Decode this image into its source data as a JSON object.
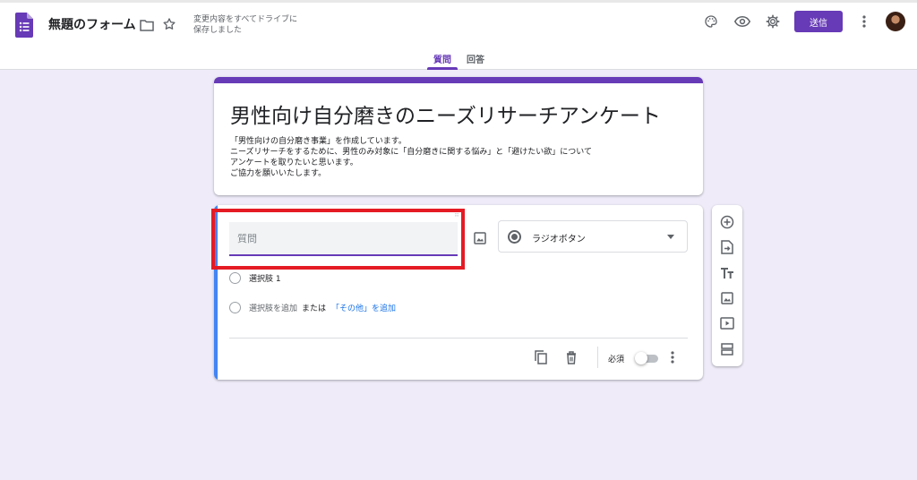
{
  "header": {
    "title": "無題のフォーム",
    "save_status_line1": "変更内容をすべてドライブに",
    "save_status_line2": "保存しました",
    "send_label": "送信",
    "icons": [
      "forms-app-icon",
      "folder-icon",
      "star-icon",
      "palette-icon",
      "eye-icon",
      "gear-icon",
      "more-vert-icon",
      "avatar"
    ]
  },
  "tabs": [
    {
      "label": "質問",
      "active": true
    },
    {
      "label": "回答",
      "active": false
    }
  ],
  "form": {
    "title": "男性向け自分磨きのニーズリサーチアンケート",
    "description_lines": [
      "「男性向けの自分磨き事業」を作成しています。",
      "ニーズリサーチをするために、男性のみ対象に「自分磨きに関する悩み」と「避けたい欲」について",
      "アンケートを取りたいと思います。",
      "ご協力を願いいたします。"
    ]
  },
  "question": {
    "placeholder": "質問",
    "type_label": "ラジオボタン",
    "option1": "選択肢 1",
    "add_option": "選択肢を追加",
    "or_label": "または",
    "add_other": "「その他」を追加",
    "required_label": "必須",
    "required_on": false
  },
  "colors": {
    "accent": "#673ab7",
    "background": "#efebf8",
    "active_bar": "#4285f4",
    "link": "#1a73e8",
    "highlight": "#e51b24"
  }
}
